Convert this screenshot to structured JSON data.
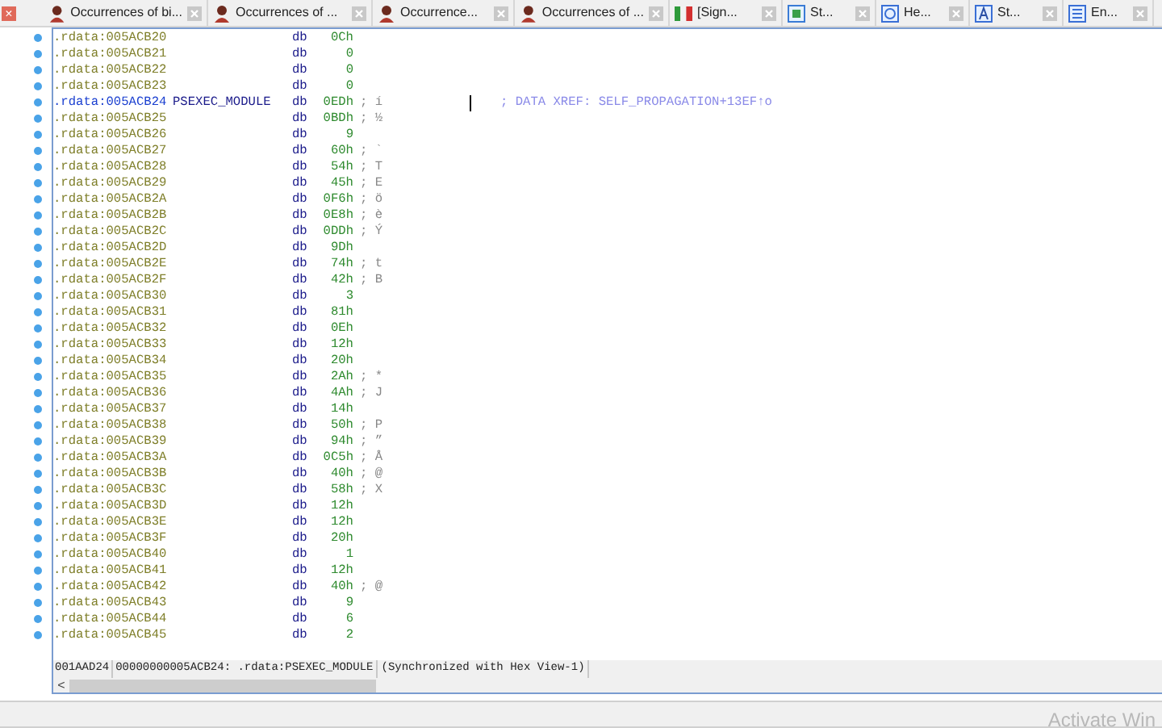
{
  "close_button": {
    "label": "×"
  },
  "tabs": [
    {
      "title": "Occurrences of bi...",
      "kind": "person",
      "selected": false
    },
    {
      "title": "Occurrences of ...",
      "kind": "person",
      "selected": false
    },
    {
      "title": "Occurrence...",
      "kind": "person",
      "selected": false
    },
    {
      "title": "Occurrences of ...",
      "kind": "person",
      "selected": false
    },
    {
      "title": "[Sign...",
      "kind": "flag",
      "selected": false
    },
    {
      "title": "St...",
      "kind": "structs",
      "selected": false
    },
    {
      "title": "He...",
      "kind": "hex",
      "selected": false
    },
    {
      "title": "St...",
      "kind": "strings",
      "selected": false
    },
    {
      "title": "En...",
      "kind": "enums",
      "selected": false
    }
  ],
  "listing": {
    "rows": [
      {
        "address": ".rdata:005ACB20",
        "mnemonic": "db",
        "value": "0Ch",
        "selected": false
      },
      {
        "address": ".rdata:005ACB21",
        "mnemonic": "db",
        "value": "0",
        "selected": false
      },
      {
        "address": ".rdata:005ACB22",
        "mnemonic": "db",
        "value": "0",
        "selected": false
      },
      {
        "address": ".rdata:005ACB23",
        "mnemonic": "db",
        "value": "0",
        "selected": false
      },
      {
        "address": ".rdata:005ACB24",
        "label": "PSEXEC_MODULE",
        "mnemonic": "db",
        "value": "0EDh",
        "comment": "; í",
        "xref": "; DATA XREF: SELF_PROPAGATION+13EF↑o",
        "selected": true
      },
      {
        "address": ".rdata:005ACB25",
        "mnemonic": "db",
        "value": "0BDh",
        "comment": "; ½",
        "selected": false
      },
      {
        "address": ".rdata:005ACB26",
        "mnemonic": "db",
        "value": "9",
        "selected": false
      },
      {
        "address": ".rdata:005ACB27",
        "mnemonic": "db",
        "value": "60h",
        "comment": "; `",
        "selected": false
      },
      {
        "address": ".rdata:005ACB28",
        "mnemonic": "db",
        "value": "54h",
        "comment": "; T",
        "selected": false
      },
      {
        "address": ".rdata:005ACB29",
        "mnemonic": "db",
        "value": "45h",
        "comment": "; E",
        "selected": false
      },
      {
        "address": ".rdata:005ACB2A",
        "mnemonic": "db",
        "value": "0F6h",
        "comment": "; ö",
        "selected": false
      },
      {
        "address": ".rdata:005ACB2B",
        "mnemonic": "db",
        "value": "0E8h",
        "comment": "; è",
        "selected": false
      },
      {
        "address": ".rdata:005ACB2C",
        "mnemonic": "db",
        "value": "0DDh",
        "comment": "; Ý",
        "selected": false
      },
      {
        "address": ".rdata:005ACB2D",
        "mnemonic": "db",
        "value": "9Dh",
        "selected": false
      },
      {
        "address": ".rdata:005ACB2E",
        "mnemonic": "db",
        "value": "74h",
        "comment": "; t",
        "selected": false
      },
      {
        "address": ".rdata:005ACB2F",
        "mnemonic": "db",
        "value": "42h",
        "comment": "; B",
        "selected": false
      },
      {
        "address": ".rdata:005ACB30",
        "mnemonic": "db",
        "value": "3",
        "selected": false
      },
      {
        "address": ".rdata:005ACB31",
        "mnemonic": "db",
        "value": "81h",
        "selected": false
      },
      {
        "address": ".rdata:005ACB32",
        "mnemonic": "db",
        "value": "0Eh",
        "selected": false
      },
      {
        "address": ".rdata:005ACB33",
        "mnemonic": "db",
        "value": "12h",
        "selected": false
      },
      {
        "address": ".rdata:005ACB34",
        "mnemonic": "db",
        "value": "20h",
        "selected": false
      },
      {
        "address": ".rdata:005ACB35",
        "mnemonic": "db",
        "value": "2Ah",
        "comment": "; *",
        "selected": false
      },
      {
        "address": ".rdata:005ACB36",
        "mnemonic": "db",
        "value": "4Ah",
        "comment": "; J",
        "selected": false
      },
      {
        "address": ".rdata:005ACB37",
        "mnemonic": "db",
        "value": "14h",
        "selected": false
      },
      {
        "address": ".rdata:005ACB38",
        "mnemonic": "db",
        "value": "50h",
        "comment": "; P",
        "selected": false
      },
      {
        "address": ".rdata:005ACB39",
        "mnemonic": "db",
        "value": "94h",
        "comment": "; ”",
        "selected": false
      },
      {
        "address": ".rdata:005ACB3A",
        "mnemonic": "db",
        "value": "0C5h",
        "comment": "; Å",
        "selected": false
      },
      {
        "address": ".rdata:005ACB3B",
        "mnemonic": "db",
        "value": "40h",
        "comment": "; @",
        "selected": false
      },
      {
        "address": ".rdata:005ACB3C",
        "mnemonic": "db",
        "value": "58h",
        "comment": "; X",
        "selected": false
      },
      {
        "address": ".rdata:005ACB3D",
        "mnemonic": "db",
        "value": "12h",
        "selected": false
      },
      {
        "address": ".rdata:005ACB3E",
        "mnemonic": "db",
        "value": "12h",
        "selected": false
      },
      {
        "address": ".rdata:005ACB3F",
        "mnemonic": "db",
        "value": "20h",
        "selected": false
      },
      {
        "address": ".rdata:005ACB40",
        "mnemonic": "db",
        "value": "1",
        "selected": false
      },
      {
        "address": ".rdata:005ACB41",
        "mnemonic": "db",
        "value": "12h",
        "selected": false
      },
      {
        "address": ".rdata:005ACB42",
        "mnemonic": "db",
        "value": "40h",
        "comment": "; @",
        "selected": false
      },
      {
        "address": ".rdata:005ACB43",
        "mnemonic": "db",
        "value": "9",
        "selected": false
      },
      {
        "address": ".rdata:005ACB44",
        "mnemonic": "db",
        "value": "6",
        "selected": false
      },
      {
        "address": ".rdata:005ACB45",
        "mnemonic": "db",
        "value": "2",
        "selected": false
      }
    ]
  },
  "status_bar": {
    "file_offset": "001AAD24",
    "location": "00000000005ACB24: .rdata:PSEXEC_MODULE",
    "sync": "(Synchronized with Hex View-1)"
  },
  "scroll_left": "<",
  "activation_notice": "Activate Win"
}
